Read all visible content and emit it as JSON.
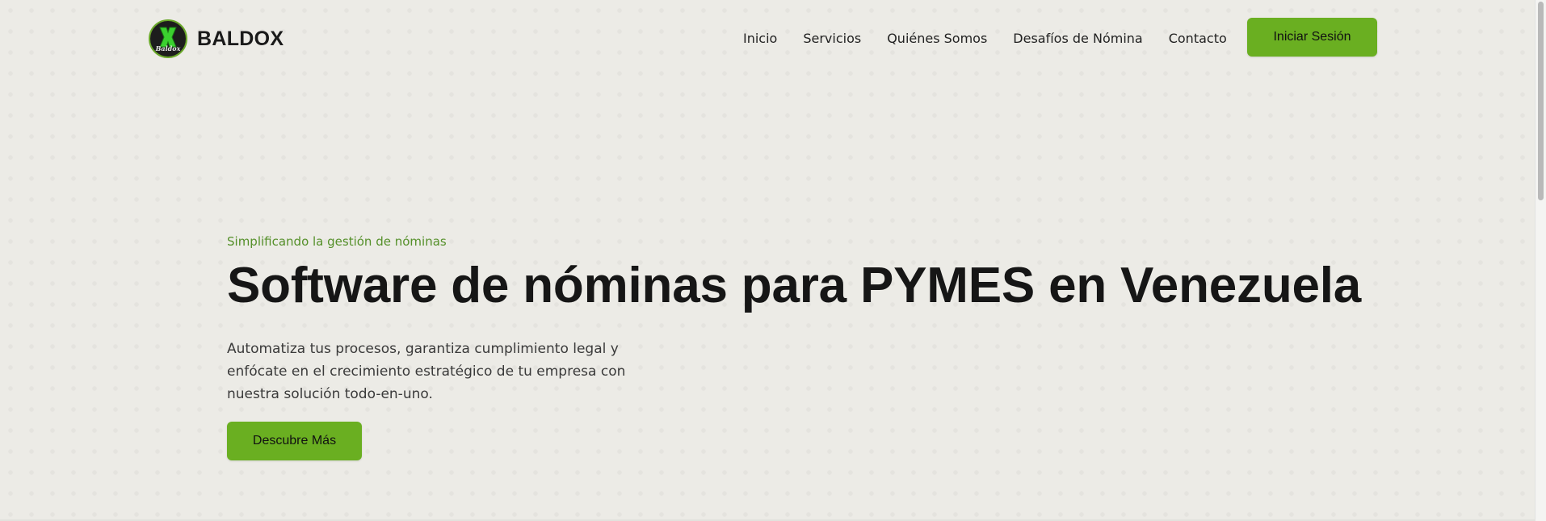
{
  "brand": {
    "name": "BALDOX",
    "logo_text": "Baldox"
  },
  "nav": {
    "items": [
      {
        "label": "Inicio"
      },
      {
        "label": "Servicios"
      },
      {
        "label": "Quiénes Somos"
      },
      {
        "label": "Desafíos de Nómina"
      },
      {
        "label": "Contacto"
      }
    ],
    "login_label": "Iniciar Sesión"
  },
  "hero": {
    "tagline": "Simplificando la gestión de nóminas",
    "headline": "Software de nóminas para PYMES en Venezuela",
    "description": "Automatiza tus procesos, garantiza cumplimiento legal y enfócate en el crecimiento estratégico de tu empresa con nuestra solución todo-en-uno.",
    "cta_label": "Descubre Más"
  },
  "colors": {
    "background": "#ecebe6",
    "accent_green": "#6aaf21",
    "tagline_green": "#55902a",
    "text_dark": "#161616"
  }
}
